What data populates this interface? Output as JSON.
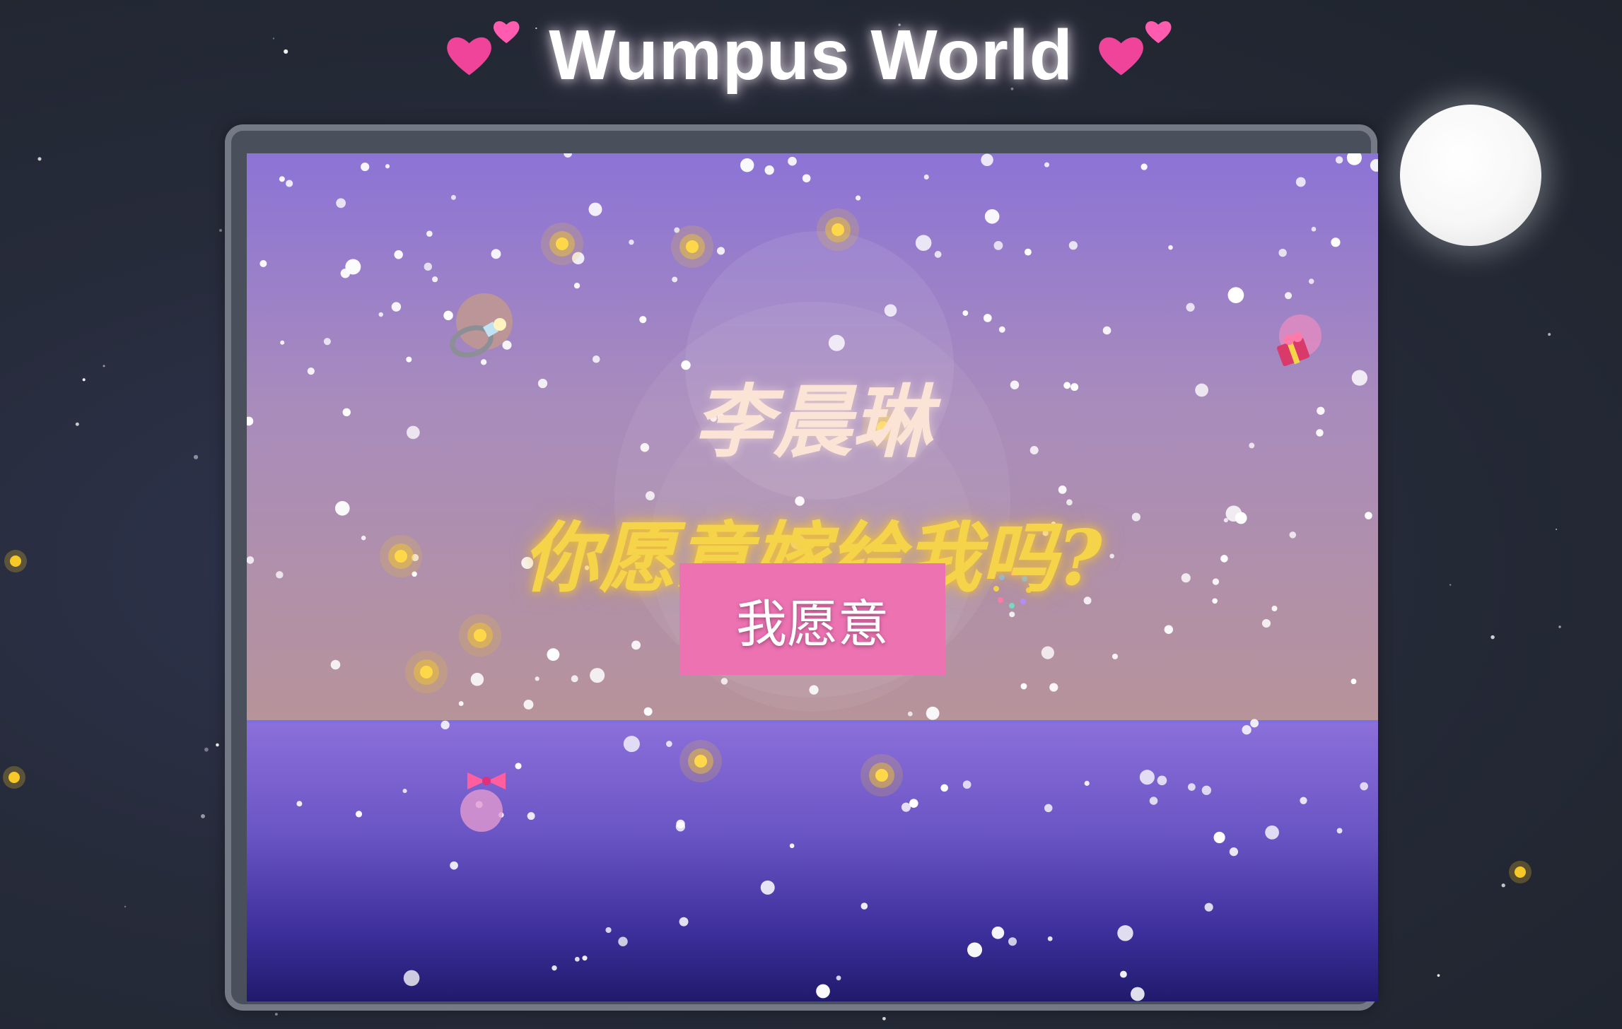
{
  "header": {
    "title": "Wumpus World",
    "left_icon": "two-hearts-icon",
    "right_icon": "two-hearts-icon"
  },
  "scene": {
    "name": "李晨琳",
    "question": "你愿意嫁给我吗?",
    "accept_button_label": "我愿意",
    "decorations": [
      "ring-icon",
      "gift-icon",
      "ribbon-bow-icon",
      "confetti-icon",
      "moon",
      "fireflies",
      "snowflakes",
      "stars"
    ]
  },
  "colors": {
    "title_text": "#ffffff",
    "name_text": "#fbe4d6",
    "question_text": "#f5d44a",
    "button_bg": "#ec72b2",
    "sky_top": "#8c73d6",
    "sky_bottom": "#b7939a",
    "sea_top": "#8b6fda",
    "sea_bottom": "#201a6c",
    "firefly": "#f6c928",
    "frame_border": "#737985"
  }
}
